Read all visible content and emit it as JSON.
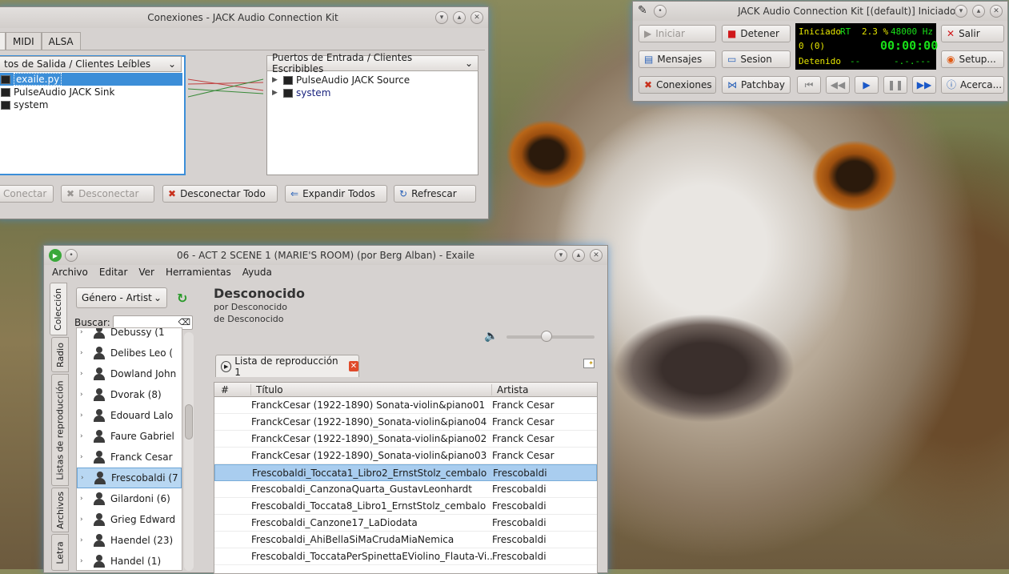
{
  "conexiones": {
    "title": "Conexiones - JACK Audio Connection Kit",
    "tabs": [
      "MIDI",
      "ALSA"
    ],
    "output_header": "tos de Salida / Clientes Leíbles",
    "input_header": "Puertos de Entrada / Clientes Escribibles",
    "output_clients": [
      "exaile.py",
      "PulseAudio JACK Sink",
      "system"
    ],
    "input_clients": [
      "PulseAudio JACK Source",
      "system"
    ],
    "buttons": {
      "connect": "Conectar",
      "disconnect": "Desconectar",
      "disconnect_all": "Desconectar Todo",
      "expand_all": "Expandir Todos",
      "refresh": "Refrescar"
    }
  },
  "jack": {
    "title": "JACK Audio Connection Kit [(default)] Iniciado.",
    "buttons": {
      "start": "Iniciar",
      "stop": "Detener",
      "messages": "Mensajes",
      "session": "Sesion",
      "connections": "Conexiones",
      "patchbay": "Patchbay",
      "quit": "Salir",
      "setup": "Setup...",
      "about": "Acerca..."
    },
    "lcd": {
      "status": "Iniciado",
      "rt": "RT",
      "load": "2.3 %",
      "rate": "48000 Hz",
      "xruns": "0 (0)",
      "time": "00:00:00",
      "transport": "Detenido",
      "dashes": "--",
      "bbt": "-.-.---"
    }
  },
  "exaile": {
    "title": "06 - ACT 2 SCENE 1 (MARIE'S ROOM) (por Berg Alban) - Exaile",
    "menu": [
      "Archivo",
      "Editar",
      "Ver",
      "Herramientas",
      "Ayuda"
    ],
    "side_tabs": [
      "Colección",
      "Radio",
      "Listas de reproducción",
      "Archivos",
      "Letra"
    ],
    "collection_view": "Género - Artist",
    "search_label": "Buscar:",
    "artists": [
      {
        "name": "Debussy (1",
        "selected": false
      },
      {
        "name": "Delibes Leo (",
        "selected": false
      },
      {
        "name": "Dowland John",
        "selected": false
      },
      {
        "name": "Dvorak (8)",
        "selected": false
      },
      {
        "name": "Edouard Lalo",
        "selected": false
      },
      {
        "name": "Faure Gabriel",
        "selected": false
      },
      {
        "name": "Franck Cesar",
        "selected": false
      },
      {
        "name": "Frescobaldi (7",
        "selected": true
      },
      {
        "name": "Gilardoni (6)",
        "selected": false
      },
      {
        "name": "Grieg Edward",
        "selected": false
      },
      {
        "name": "Haendel (23)",
        "selected": false
      },
      {
        "name": "Handel (1)",
        "selected": false
      }
    ],
    "now_playing": {
      "title": "Desconocido",
      "by": "por Desconocido",
      "from": "de Desconocido"
    },
    "volume_level": 0.45,
    "playlist_tab": "Lista de reproducción 1",
    "columns": {
      "num": "#",
      "title": "Título",
      "artist": "Artista"
    },
    "tracks": [
      {
        "title": "FranckCesar (1922-1890) Sonata-violin&piano01",
        "artist": "Franck Cesar",
        "selected": false
      },
      {
        "title": "FranckCesar (1922-1890)_Sonata-violin&piano04",
        "artist": "Franck Cesar",
        "selected": false
      },
      {
        "title": "FranckCesar (1922-1890)_Sonata-violin&piano02",
        "artist": "Franck Cesar",
        "selected": false
      },
      {
        "title": "FranckCesar (1922-1890)_Sonata-violin&piano03",
        "artist": "Franck Cesar",
        "selected": false
      },
      {
        "title": "Frescobaldi_Toccata1_Libro2_ErnstStolz_cembalo",
        "artist": "Frescobaldi",
        "selected": true
      },
      {
        "title": "Frescobaldi_CanzonaQuarta_GustavLeonhardt",
        "artist": "Frescobaldi",
        "selected": false
      },
      {
        "title": "Frescobaldi_Toccata8_Libro1_ErnstStolz_cembalo",
        "artist": "Frescobaldi",
        "selected": false
      },
      {
        "title": "Frescobaldi_Canzone17_LaDiodata",
        "artist": "Frescobaldi",
        "selected": false
      },
      {
        "title": "Frescobaldi_AhiBellaSiMaCrudaMiaNemica",
        "artist": "Frescobaldi",
        "selected": false
      },
      {
        "title": "Frescobaldi_ToccataPerSpinettaEViolino_Flauta-Vi...",
        "artist": "Frescobaldi",
        "selected": false
      }
    ]
  },
  "colors": {
    "accent": "#3c8ed8",
    "lcd_yellow": "#e6e600",
    "lcd_green": "#18e018",
    "close_red": "#e04a2a"
  },
  "icons": [
    "pencil-icon",
    "play-icon",
    "pause-icon",
    "stop-icon",
    "speaker-icon",
    "refresh-icon",
    "clear-icon",
    "person-icon"
  ]
}
